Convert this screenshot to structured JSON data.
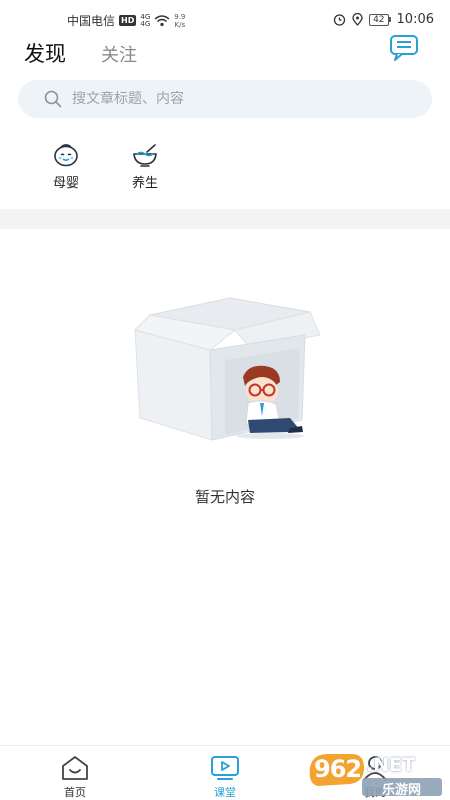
{
  "status_bar": {
    "carrier": "中国电信",
    "hd": "HD",
    "net_top": "4G",
    "net_bottom": "4G",
    "speed_value": "9.9",
    "speed_unit": "K/s",
    "battery": "42",
    "time": "10:06"
  },
  "header": {
    "tab_active": "发现",
    "tab_inactive": "关注"
  },
  "search": {
    "placeholder": "搜文章标题、内容"
  },
  "categories": [
    {
      "label": "母婴",
      "icon": "baby-face-icon"
    },
    {
      "label": "养生",
      "icon": "health-bowl-icon"
    }
  ],
  "empty_state": {
    "text": "暂无内容"
  },
  "bottom_nav": [
    {
      "label": "首页",
      "icon": "home-icon",
      "active": false
    },
    {
      "label": "课堂",
      "icon": "classroom-play-icon",
      "active": true
    },
    {
      "label": "我的",
      "icon": "profile-icon",
      "active": false
    }
  ],
  "watermark": {
    "brand": "962",
    "suffix": ".NET",
    "sub": "乐游网"
  },
  "colors": {
    "accent": "#2aa0d8",
    "search_bg": "#eef3f8",
    "divider": "#f4f4f4",
    "watermark_orange": "#f39a1e"
  }
}
